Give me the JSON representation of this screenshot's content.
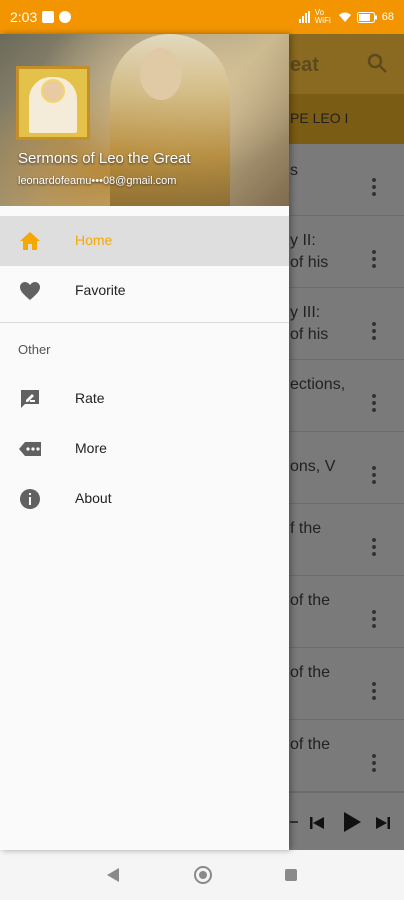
{
  "status_bar": {
    "time": "2:03",
    "network": "Vo WiFi",
    "battery": "68"
  },
  "background_app": {
    "title": "eat",
    "tab_label": "PE LEO I",
    "list": [
      {
        "line1": "s",
        "line2": ""
      },
      {
        "line1": "y II:",
        "line2": "of his"
      },
      {
        "line1": "y III:",
        "line2": "of his"
      },
      {
        "line1": "ections,",
        "line2": ""
      },
      {
        "line1": "ons, V",
        "line2": ""
      },
      {
        "line1": "f the",
        "line2": ""
      },
      {
        "line1": "of the",
        "line2": ""
      },
      {
        "line1": "of the",
        "line2": ""
      },
      {
        "line1": "of the",
        "line2": ""
      }
    ]
  },
  "drawer": {
    "header": {
      "title": "Sermons of Leo the Great",
      "email": "leonardofeamu•••08@gmail.com"
    },
    "items": [
      {
        "label": "Home",
        "icon": "home-icon",
        "active": true
      },
      {
        "label": "Favorite",
        "icon": "heart-icon",
        "active": false
      }
    ],
    "section_label": "Other",
    "other_items": [
      {
        "label": "Rate",
        "icon": "rate-icon"
      },
      {
        "label": "More",
        "icon": "more-icon"
      },
      {
        "label": "About",
        "icon": "info-icon"
      }
    ]
  },
  "colors": {
    "accent": "#F29500",
    "active_label": "#F6A800"
  }
}
